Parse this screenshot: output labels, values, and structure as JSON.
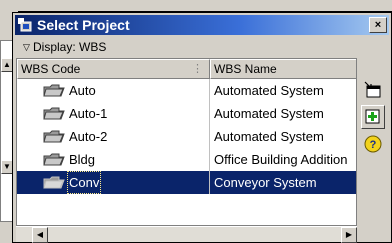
{
  "dialog": {
    "title": "Select Project",
    "close_glyph": "×",
    "display_label": "Display: WBS"
  },
  "grid": {
    "columns": [
      "WBS Code",
      "WBS Name"
    ],
    "rows": [
      {
        "code": "Auto",
        "name": "Automated System"
      },
      {
        "code": "Auto-1",
        "name": "Automated System"
      },
      {
        "code": "Auto-2",
        "name": "Automated System"
      },
      {
        "code": "Bldg",
        "name": "Office Building Addition"
      },
      {
        "code": "Conv",
        "name": "Conveyor System",
        "selected": true
      }
    ]
  },
  "side_icons": [
    "collapse-window-icon",
    "add-green-plus-icon",
    "help-icon"
  ],
  "colors": {
    "title_start": "#0a246a",
    "title_end": "#a6caf0",
    "selection": "#0a246a",
    "folder": "#808080"
  }
}
